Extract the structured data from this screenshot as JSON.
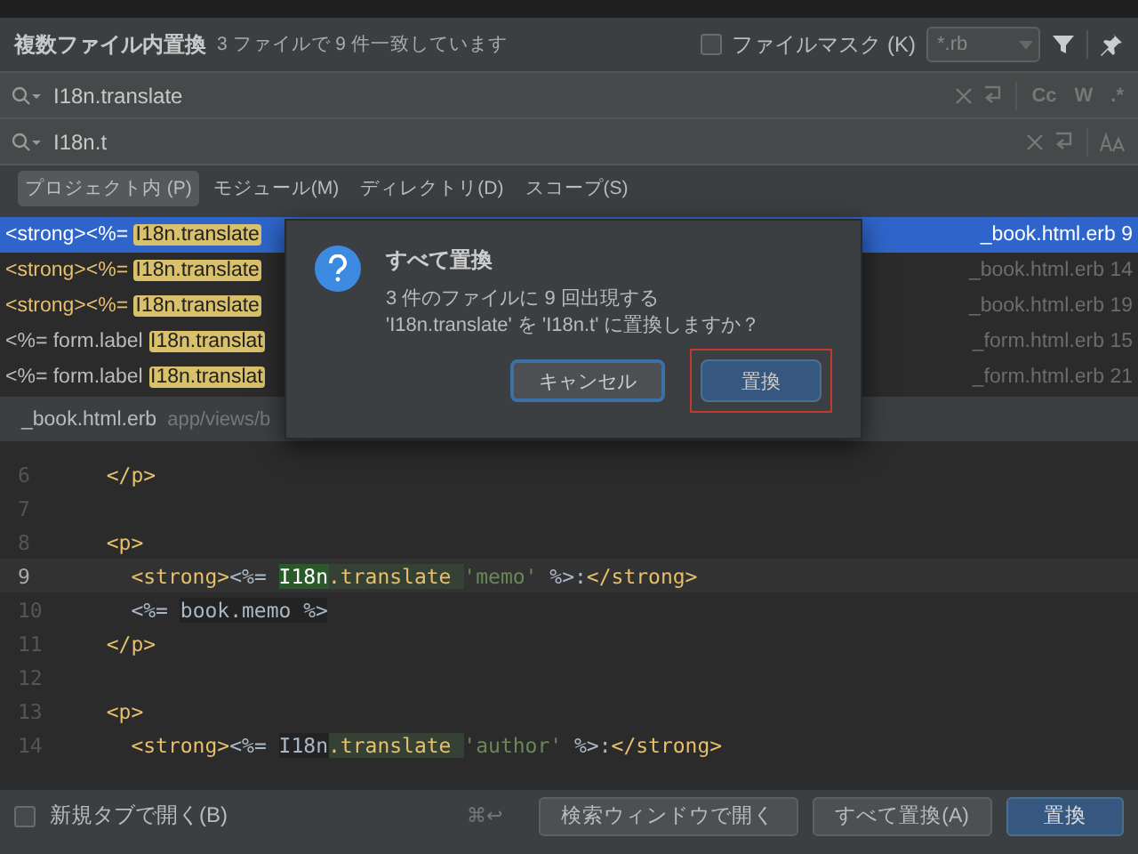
{
  "header": {
    "title": "複数ファイル内置換",
    "summary": "3 ファイルで 9 件一致しています",
    "file_mask": {
      "label": "ファイルマスク (K)",
      "checked": false,
      "value": "*.rb"
    }
  },
  "search": {
    "value": "I18n.translate",
    "options": [
      "Cc",
      "W",
      ".*"
    ]
  },
  "replace": {
    "value": "I18n.t"
  },
  "scopes": [
    {
      "label": "プロジェクト内 (P)",
      "selected": true
    },
    {
      "label": "モジュール(M)",
      "selected": false
    },
    {
      "label": "ディレクトリ(D)",
      "selected": false
    },
    {
      "label": "スコープ(S)",
      "selected": false
    }
  ],
  "results": [
    {
      "prefix": "<strong><%= ",
      "match": "I18n.translate",
      "kind": "strong",
      "file": "_book.html.erb 9",
      "selected": true
    },
    {
      "prefix": "<strong><%= ",
      "match": "I18n.translate",
      "kind": "strong",
      "file": "_book.html.erb 14",
      "selected": false
    },
    {
      "prefix": "<strong><%= ",
      "match": "I18n.translate",
      "kind": "strong",
      "file": "_book.html.erb 19",
      "selected": false
    },
    {
      "prefix": "<%= form.label ",
      "match": "I18n.translat",
      "kind": "plain",
      "file": "_form.html.erb 15",
      "selected": false
    },
    {
      "prefix": "<%= form.label ",
      "match": "I18n.translat",
      "kind": "plain",
      "file": "_form.html.erb 21",
      "selected": false
    }
  ],
  "path": {
    "file": "_book.html.erb",
    "folder": "app/views/b"
  },
  "code": {
    "lines": [
      {
        "number": "6",
        "current": false,
        "tokens": [
          {
            "kind": "tag",
            "text": "  </p>"
          }
        ]
      },
      {
        "number": "7",
        "current": false
      },
      {
        "number": "8",
        "current": false,
        "tokens": [
          {
            "kind": "tag",
            "text": "  <p>"
          }
        ]
      },
      {
        "number": "9",
        "current": true,
        "tokens": [
          {
            "kind": "tag",
            "text": "    <strong>"
          },
          {
            "kind": "erb",
            "text": "<%= "
          },
          {
            "kind": "match",
            "text": "I18n"
          },
          {
            "kind": "method",
            "text": ".translate "
          },
          {
            "kind": "string",
            "text": "'memo'"
          },
          {
            "kind": "erb",
            "text": " %>:"
          },
          {
            "kind": "tag",
            "text": "</strong>"
          }
        ]
      },
      {
        "number": "10",
        "current": false,
        "tokens": [
          {
            "kind": "erb",
            "text": "    <%= "
          },
          {
            "kind": "block",
            "text": "book.memo %>"
          }
        ]
      },
      {
        "number": "11",
        "current": false,
        "tokens": [
          {
            "kind": "tag",
            "text": "  </p>"
          }
        ]
      },
      {
        "number": "12",
        "current": false
      },
      {
        "number": "13",
        "current": false,
        "tokens": [
          {
            "kind": "tag",
            "text": "  <p>"
          }
        ]
      },
      {
        "number": "14",
        "current": false,
        "tokens": [
          {
            "kind": "tag",
            "text": "    <strong>"
          },
          {
            "kind": "erb",
            "text": "<%= "
          },
          {
            "kind": "block",
            "text": "I18n"
          },
          {
            "kind": "method",
            "text": ".translate "
          },
          {
            "kind": "string",
            "text": "'author'"
          },
          {
            "kind": "erb",
            "text": " %>:"
          },
          {
            "kind": "tag",
            "text": "</strong>"
          }
        ]
      }
    ]
  },
  "footer": {
    "new_tab": {
      "label": "新規タブで開く(B)",
      "checked": false
    },
    "shortcut": "⌘↩",
    "buttons": [
      {
        "label": "検索ウィンドウで開く",
        "kind": "normal"
      },
      {
        "label": "すべて置換(A)",
        "kind": "normal"
      },
      {
        "label": "置換",
        "kind": "primary"
      }
    ]
  },
  "dialog": {
    "title": "すべて置換",
    "message": [
      "3 件のファイルに 9 回出現する",
      "'I18n.translate' を 'I18n.t' に置換しますか？"
    ],
    "buttons": [
      {
        "label": "キャンセル",
        "kind": "cancel"
      },
      {
        "label": "置換",
        "kind": "default"
      }
    ]
  }
}
